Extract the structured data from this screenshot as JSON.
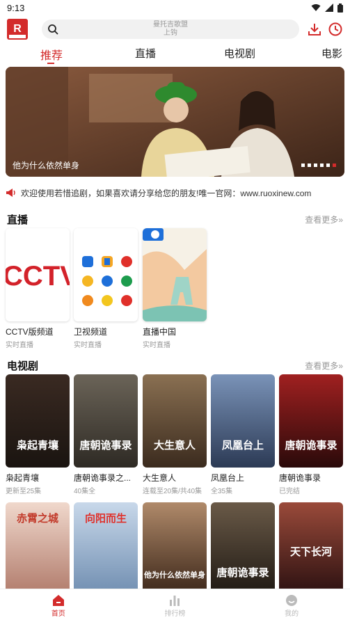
{
  "status": {
    "time": "9:13"
  },
  "header": {
    "logo_text": "R",
    "search_line1": "曼托吉歌盟",
    "search_line2": "上钩"
  },
  "tabs": [
    "推荐",
    "直播",
    "电视剧",
    "电影"
  ],
  "banner": {
    "caption": "他为什么依然单身",
    "dots": 6,
    "active_dot": 5
  },
  "notice": "欢迎使用若惜追剧，如果喜欢请分享给您的朋友!唯一官网：www.ruoxinew.com",
  "live": {
    "title": "直播",
    "more": "查看更多",
    "items": [
      {
        "title": "CCTV版频道",
        "sub": "实时直播",
        "logo": "CCTV"
      },
      {
        "title": "卫视频道",
        "sub": "实时直播"
      },
      {
        "title": "直播中国",
        "sub": "实时直播"
      }
    ]
  },
  "tv": {
    "title": "电视剧",
    "more": "查看更多",
    "items": [
      {
        "title": "枭起青壤",
        "sub": "更新至25集",
        "poster_text": "枭起青壤",
        "color1": "#3a2a22",
        "color2": "#1a1410"
      },
      {
        "title": "唐朝诡事录之...",
        "sub": "40集全",
        "poster_text": "唐朝诡事录",
        "color1": "#6b6458",
        "color2": "#2e2a24"
      },
      {
        "title": "大生意人",
        "sub": "连载至20集/共40集",
        "poster_text": "大生意人",
        "color1": "#8a7052",
        "color2": "#3b2b1e"
      },
      {
        "title": "凤凰台上",
        "sub": "全35集",
        "poster_text": "凤凰台上",
        "color1": "#7a93b8",
        "color2": "#2c3a55"
      },
      {
        "title": "唐朝诡事录",
        "sub": "已完结",
        "poster_text": "唐朝诡事录",
        "color1": "#a02020",
        "color2": "#2a0a0a"
      }
    ],
    "row2": [
      {
        "poster_text": "赤霄之城",
        "color1": "#f0d8cc",
        "color2": "#b07a6a"
      },
      {
        "poster_text": "向阳而生",
        "color1": "#c8d8ea",
        "color2": "#6f8db0"
      },
      {
        "poster_text": "他为什么依然单身",
        "color1": "#b08a6a",
        "color2": "#3a2518"
      },
      {
        "poster_text": "唐朝诡事录",
        "color1": "#6a5a48",
        "color2": "#1e1812"
      },
      {
        "poster_text": "天下长河",
        "color1": "#9a4a3a",
        "color2": "#2a1010"
      }
    ]
  },
  "bottom_nav": [
    "首页",
    "排行榜",
    "我的"
  ],
  "colors": {
    "accent": "#d32b2b"
  }
}
